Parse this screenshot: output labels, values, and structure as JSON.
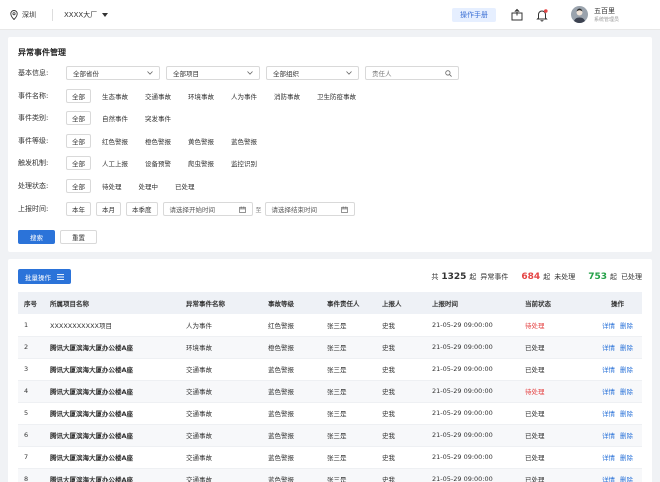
{
  "topbar": {
    "city": "深圳",
    "factory": "XXXX大厂",
    "manual_label": "操作手册",
    "user_name": "五百里",
    "user_role": "系统管理员"
  },
  "filter": {
    "title": "异常事件管理",
    "basic_info_label": "基本信息:",
    "province_placeholder": "全部省份",
    "project_placeholder": "全部项目",
    "org_placeholder": "全部组织",
    "owner_placeholder": "责任人",
    "event_name_label": "事件名称:",
    "event_name_options": [
      "全部",
      "生态事故",
      "交通事故",
      "环境事故",
      "人为事件",
      "消防事故",
      "卫生防疫事故"
    ],
    "event_type_label": "事件类别:",
    "event_type_options": [
      "全部",
      "自然事件",
      "突发事件"
    ],
    "event_level_label": "事件等级:",
    "event_level_options": [
      "全部",
      "红色警报",
      "橙色警报",
      "黄色警报",
      "蓝色警报"
    ],
    "trigger_label": "触发机制:",
    "trigger_options": [
      "全部",
      "人工上报",
      "设备预警",
      "爬虫警报",
      "监控识别"
    ],
    "status_label": "处理状态:",
    "status_options": [
      "全部",
      "待处理",
      "处理中",
      "已处理"
    ],
    "time_label": "上报时间:",
    "time_options": [
      "本年",
      "本月",
      "本季度"
    ],
    "start_placeholder": "请选择开始时间",
    "range_sep": "至",
    "end_placeholder": "请选择结束时间",
    "search_label": "搜索",
    "reset_label": "重置"
  },
  "table": {
    "batch_label": "批量操作",
    "stats": {
      "prefix": "共",
      "total": "1325",
      "total_unit": "起",
      "total_label": "异常事件",
      "pending": "684",
      "pending_unit": "起",
      "pending_label": "未处理",
      "done": "753",
      "done_unit": "起",
      "done_label": "已处理"
    },
    "headers": [
      "序号",
      "所属项目名称",
      "异常事件名称",
      "事故等级",
      "事件责任人",
      "上报人",
      "上报时间",
      "当前状态",
      "操作"
    ],
    "detail_label": "详情",
    "delete_label": "删除",
    "rows": [
      [
        "1",
        "XXXXXXXXXXX项目",
        "人为事件",
        "红色警报",
        "张三是",
        "史我",
        "21-05-29 09:00:00",
        "待处理"
      ],
      [
        "2",
        "腾讯大厦滨海大厦办公楼A座",
        "环境事故",
        "橙色警报",
        "张三是",
        "史我",
        "21-05-29 09:00:00",
        "已处理"
      ],
      [
        "3",
        "腾讯大厦滨海大厦办公楼A座",
        "交通事故",
        "蓝色警报",
        "张三是",
        "史我",
        "21-05-29 09:00:00",
        "已处理"
      ],
      [
        "4",
        "腾讯大厦滨海大厦办公楼A座",
        "交通事故",
        "蓝色警报",
        "张三是",
        "史我",
        "21-05-29 09:00:00",
        "待处理"
      ],
      [
        "5",
        "腾讯大厦滨海大厦办公楼A座",
        "交通事故",
        "蓝色警报",
        "张三是",
        "史我",
        "21-05-29 09:00:00",
        "已处理"
      ],
      [
        "6",
        "腾讯大厦滨海大厦办公楼A座",
        "交通事故",
        "蓝色警报",
        "张三是",
        "史我",
        "21-05-29 09:00:00",
        "已处理"
      ],
      [
        "7",
        "腾讯大厦滨海大厦办公楼A座",
        "交通事故",
        "蓝色警报",
        "张三是",
        "史我",
        "21-05-29 09:00:00",
        "已处理"
      ],
      [
        "8",
        "腾讯大厦滨海大厦办公楼A座",
        "交通事故",
        "蓝色警报",
        "张三是",
        "史我",
        "21-05-29 09:00:00",
        "已处理"
      ]
    ]
  },
  "colors": {
    "primary": "#2b73d9",
    "pending": "#e54545",
    "done_count": "#24a148"
  }
}
